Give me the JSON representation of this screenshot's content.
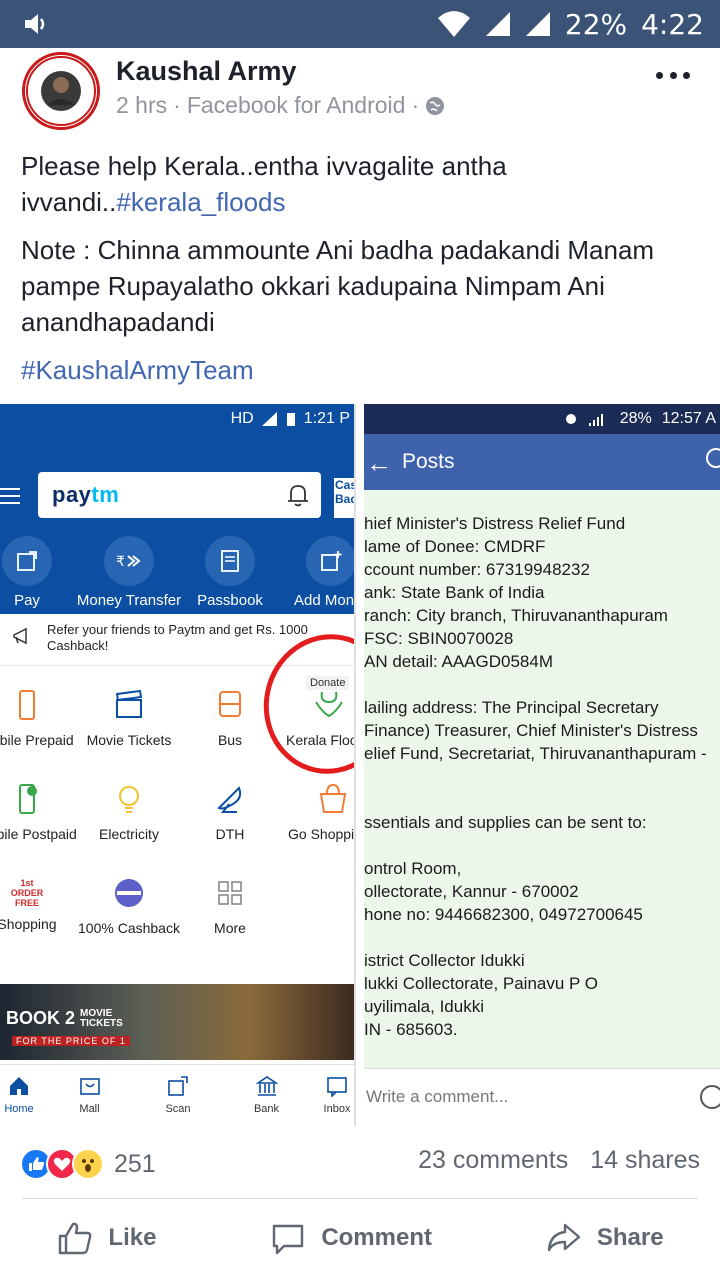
{
  "status_bar": {
    "battery": "22%",
    "time": "4:22"
  },
  "post": {
    "author": "Kaushal Army",
    "time": "2 hrs",
    "source": "Facebook for Android",
    "line1": "Please help Kerala..entha ivvagalite antha",
    "line2_prefix": "ivvandi..",
    "line2_tag": "#kerala_floods",
    "note_lines": [
      "Note : Chinna ammounte Ani badha padakandi Manam",
      "pampe Rupayalatho okkari kadupaina Nimpam Ani",
      "anandhapadandi"
    ],
    "hashtag": "#KaushalArmyTeam"
  },
  "paytm": {
    "status_text": "HD",
    "status_time": "1:21 P",
    "logo_main": "pay",
    "logo_accent": "tm",
    "cashback_label": "Cas Bac",
    "quick": [
      {
        "icon": "pay-icon",
        "label": "Pay"
      },
      {
        "icon": "money-transfer-icon",
        "label": "Money Transfer"
      },
      {
        "icon": "passbook-icon",
        "label": "Passbook"
      },
      {
        "icon": "add-money-icon",
        "label": "Add Mon"
      }
    ],
    "refer_text": "Refer your friends to Paytm and get Rs. 1000 Cashback!",
    "donate_tag": "Donate",
    "grid": [
      {
        "icon": "mobile-icon",
        "label": "Mobile Prepaid"
      },
      {
        "icon": "movie-icon",
        "label": "Movie Tickets"
      },
      {
        "icon": "bus-icon",
        "label": "Bus"
      },
      {
        "icon": "flood-relief-icon",
        "label": "Kerala Floo"
      },
      {
        "icon": "mobile-postpaid-icon",
        "label": "Mobile Postpaid"
      },
      {
        "icon": "electricity-icon",
        "label": "Electricity"
      },
      {
        "icon": "dth-icon",
        "label": "DTH"
      },
      {
        "icon": "shopping-bag-icon",
        "label": "Go Shoppi"
      },
      {
        "icon": "first-order-icon",
        "label": "Shopping"
      },
      {
        "icon": "cashback-icon",
        "label": "100% Cashback"
      },
      {
        "icon": "more-grid-icon",
        "label": "More"
      }
    ],
    "first_order_badge": "1st ORDER FREE",
    "banner_title": "BOOK 2",
    "banner_movie": "MOVIE TICKETS",
    "banner_sub": "FOR THE PRICE OF 1",
    "tabs": [
      "Home",
      "Mall",
      "Scan",
      "Bank",
      "Inbox"
    ]
  },
  "right_shot": {
    "status_battery": "28%",
    "status_time": "12:57 A",
    "title": "Posts",
    "lines": [
      "hief Minister's Distress Relief Fund",
      "lame of Donee: CMDRF",
      "ccount number: 67319948232",
      "ank: State Bank of India",
      "ranch: City branch, Thiruvananthapuram",
      "FSC: SBIN0070028",
      "AN detail: AAAGD0584M",
      "",
      "lailing address: The Principal Secretary",
      "Finance) Treasurer, Chief Minister's Distress",
      "elief Fund, Secretariat, Thiruvananthapuram -",
      "",
      "",
      "ssentials and supplies can be sent to:",
      "",
      "ontrol Room,",
      "ollectorate, Kannur - 670002",
      "hone no: 9446682300, 04972700645",
      "",
      "istrict Collector Idukki",
      "lukki Collectorate, Painavu P O",
      "uyilimala, Idukki",
      "IN - 685603."
    ],
    "comment_placeholder": "Write a comment..."
  },
  "engagement": {
    "reaction_count": "251",
    "comments": "23 comments",
    "shares": "14 shares",
    "like": "Like",
    "comment": "Comment",
    "share": "Share"
  },
  "colors": {
    "fb_blue": "#4267b2",
    "paytm_blue": "#0b4ea2",
    "status_bar": "#3b5376",
    "red_mark": "#e31d1d"
  }
}
